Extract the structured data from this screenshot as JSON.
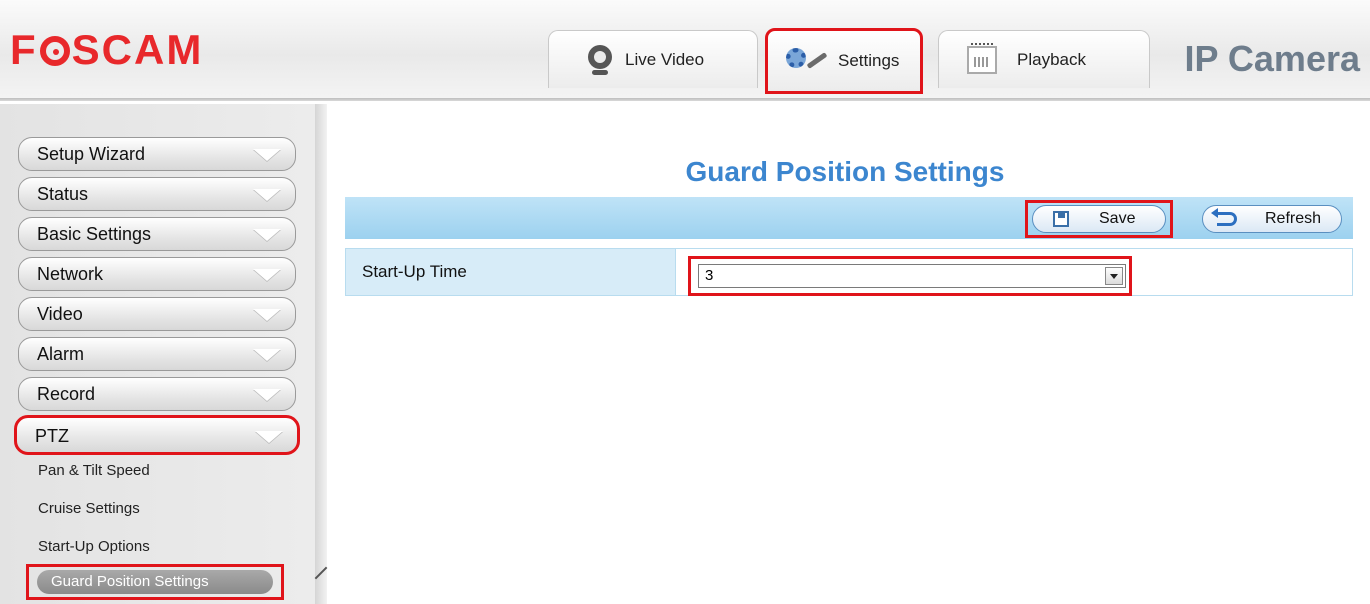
{
  "header": {
    "logo": "FOSCAM",
    "background_title": "IP Camera",
    "tabs": [
      {
        "label": "Live Video",
        "icon": "webcam-icon"
      },
      {
        "label": "Settings",
        "icon": "gear-wrench-icon",
        "selected": true
      },
      {
        "label": "Playback",
        "icon": "calendar-icon"
      }
    ]
  },
  "sidebar": {
    "menu": [
      {
        "label": "Setup Wizard"
      },
      {
        "label": "Status"
      },
      {
        "label": "Basic Settings"
      },
      {
        "label": "Network"
      },
      {
        "label": "Video"
      },
      {
        "label": "Alarm"
      },
      {
        "label": "Record"
      },
      {
        "label": "PTZ",
        "expanded": true
      }
    ],
    "submenu": [
      {
        "label": "Pan & Tilt Speed"
      },
      {
        "label": "Cruise Settings"
      },
      {
        "label": "Start-Up Options"
      },
      {
        "label": "Guard Position Settings",
        "selected": true
      }
    ]
  },
  "main": {
    "title": "Guard Position Settings",
    "toolbar": {
      "save_label": "Save",
      "refresh_label": "Refresh"
    },
    "fields": [
      {
        "label": "Start-Up Time",
        "value": "3"
      }
    ]
  },
  "colors": {
    "brand": "#e8282b",
    "title": "#3c86cf",
    "highlight": "#e0141a",
    "toolbar": "#9cd1ef"
  }
}
